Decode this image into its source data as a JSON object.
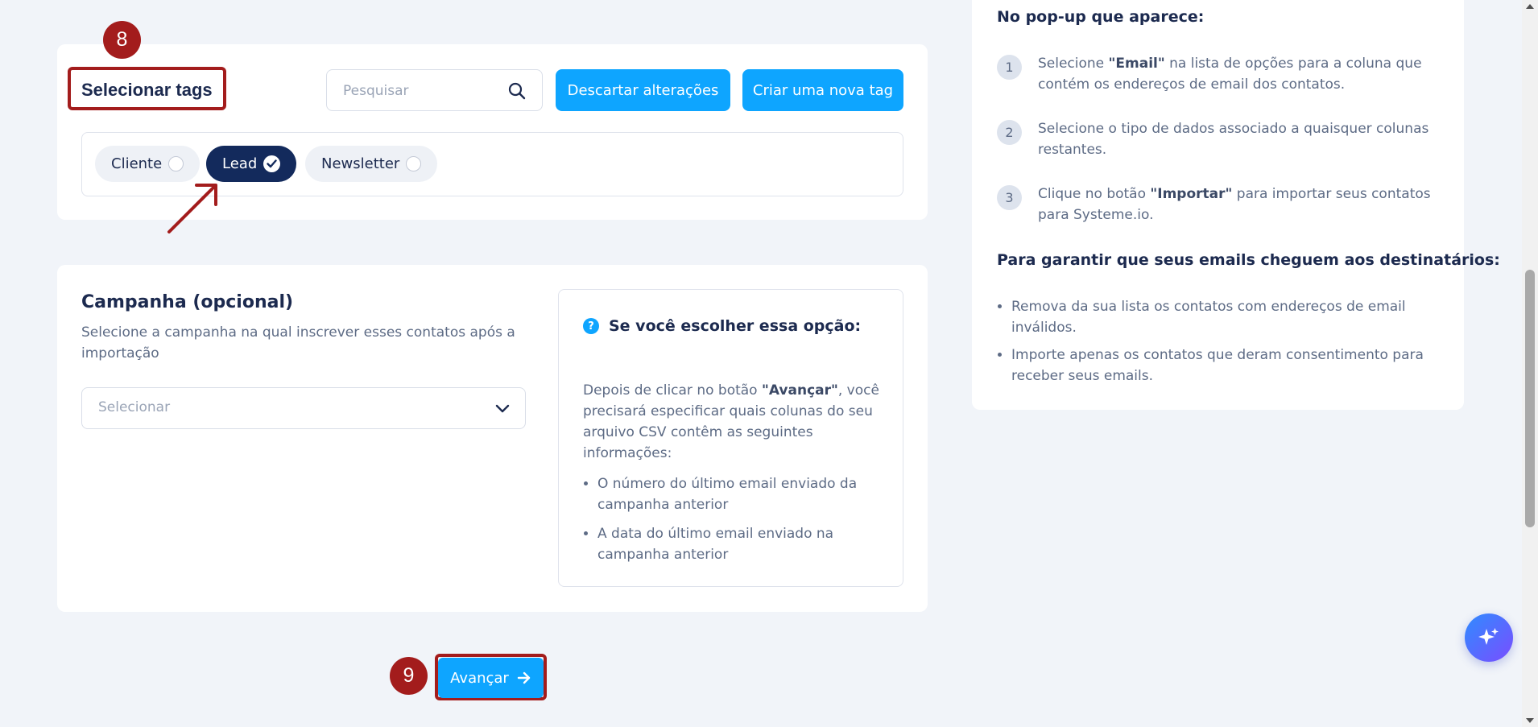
{
  "tags_section": {
    "title": "Selecionar tags",
    "search_placeholder": "Pesquisar",
    "discard_button": "Descartar alterações",
    "create_tag_button": "Criar uma nova tag",
    "tags": [
      {
        "label": "Cliente",
        "selected": false
      },
      {
        "label": "Lead",
        "selected": true
      },
      {
        "label": "Newsletter",
        "selected": false
      }
    ]
  },
  "annotations": {
    "step8": "8",
    "step9": "9",
    "color": "#a31c1c"
  },
  "campaign_section": {
    "title": "Campanha (opcional)",
    "description": "Selecione a campanha na qual inscrever esses contatos após a importação",
    "select_placeholder": "Selecionar",
    "info": {
      "heading": "Se você escolher essa opção:",
      "text_before": "Depois de clicar no botão ",
      "text_bold": "\"Avançar\"",
      "text_after": ", você precisará especificar quais colunas do seu arquivo CSV contêm as seguintes informações:",
      "items": [
        "O número do último email enviado da campanha anterior",
        "A data do último email enviado na campanha anterior"
      ]
    }
  },
  "help_panel": {
    "popup_heading": "No pop-up que aparece:",
    "steps": [
      {
        "num": "1",
        "before": "Selecione ",
        "bold": "\"Email\"",
        "after": " na lista de opções para a coluna que contém os endereços de email dos contatos."
      },
      {
        "num": "2",
        "before": "Selecione o tipo de dados associado a quaisquer colunas restantes.",
        "bold": "",
        "after": ""
      },
      {
        "num": "3",
        "before": "Clique no botão ",
        "bold": "\"Importar\"",
        "after": " para importar seus contatos para Systeme.io."
      }
    ],
    "delivery_heading": "Para garantir que seus emails cheguem aos destinatários:",
    "delivery_items": [
      "Remova da sua lista os contatos com endereços de email inválidos.",
      "Importe apenas os contatos que deram consentimento para receber seus emails."
    ]
  },
  "next_button": "Avançar",
  "colors": {
    "accent": "#0ea5ff",
    "selected_chip": "#132a5c",
    "annotation": "#a31c1c"
  }
}
